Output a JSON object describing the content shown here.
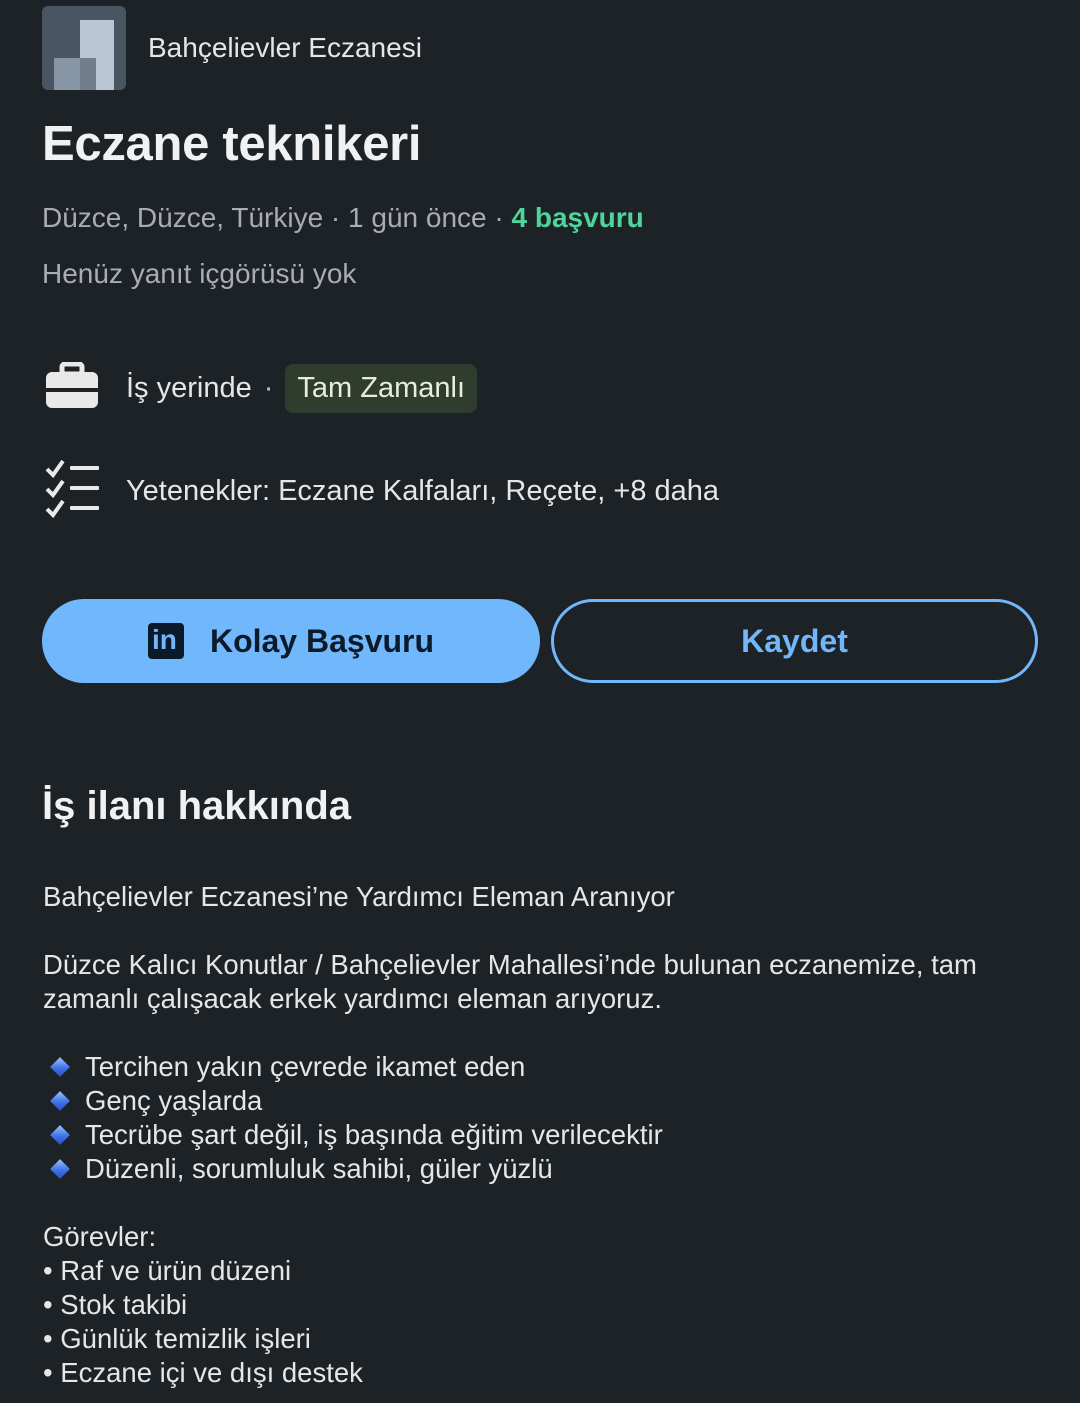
{
  "company": {
    "name": "Bahçelievler Eczanesi",
    "logo_icon": "company-logo-icon"
  },
  "job": {
    "title": "Eczane teknikeri",
    "location": "Düzce, Düzce, Türkiye",
    "posted": "1 gün önce",
    "applicants": "4 başvuru",
    "insight": "Henüz yanıt içgörüsü yok",
    "workplace": "İş yerinde",
    "employment_type": "Tam Zamanlı",
    "skills": "Yetenekler: Eczane Kalfaları, Reçete, +8 daha"
  },
  "meta_separator": " · ",
  "icons": {
    "workplace": "briefcase-icon",
    "skills": "checklist-icon",
    "apply": "linkedin-icon",
    "bullet": "blue-diamond-icon"
  },
  "colors": {
    "background": "#1d2226",
    "accent": "#71b7fb",
    "applicants_green": "#4fd49a",
    "badge_bg": "#2f3c2e"
  },
  "buttons": {
    "apply": "Kolay Başvuru",
    "save": "Kaydet"
  },
  "about": {
    "heading": "İş ilanı hakkında",
    "intro": "Bahçelievler Eczanesi’ne Yardımcı Eleman Aranıyor",
    "paragraph": "Düzce Kalıcı Konutlar / Bahçelievler Mahallesi’nde bulunan eczanemize, tam zamanlı çalışacak erkek yardımcı eleman arıyoruz.",
    "requirements": [
      "Tercihen yakın çevrede ikamet eden",
      "Genç yaşlarda",
      "Tecrübe şart değil, iş başında eğitim verilecektir",
      "Düzenli, sorumluluk sahibi, güler yüzlü"
    ],
    "duties_heading": "Görevler:",
    "duties": [
      "• Raf ve ürün düzeni",
      "• Stok takibi",
      "• Günlük temizlik işleri",
      "• Eczane içi ve dışı destek"
    ]
  }
}
